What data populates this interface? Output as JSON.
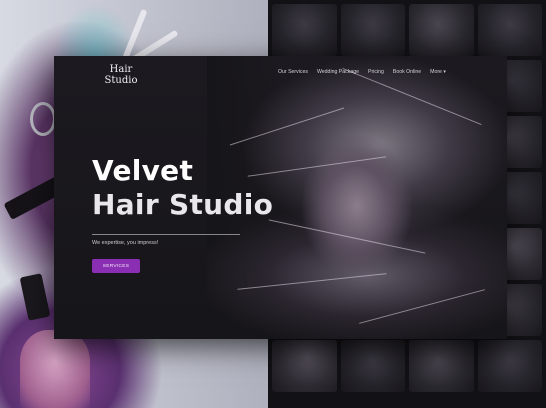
{
  "logo": {
    "line1": "Hair",
    "line2": "Studio"
  },
  "nav": {
    "items": [
      "Our Services",
      "Wedding Package",
      "Pricing",
      "Book Online",
      "More"
    ],
    "more_icon": "chevron-down-icon"
  },
  "hero": {
    "title_line1": "Velvet",
    "title_line2": "Hair Studio",
    "tagline": "We expertise, you impress!",
    "button_label": "SERVICES"
  },
  "colors": {
    "accent": "#8a2fb3",
    "background": "#161519",
    "text": "#ffffff"
  },
  "backdrop": {
    "left_photo": "stylist-with-purple-hair",
    "collage_tiles": 28
  }
}
